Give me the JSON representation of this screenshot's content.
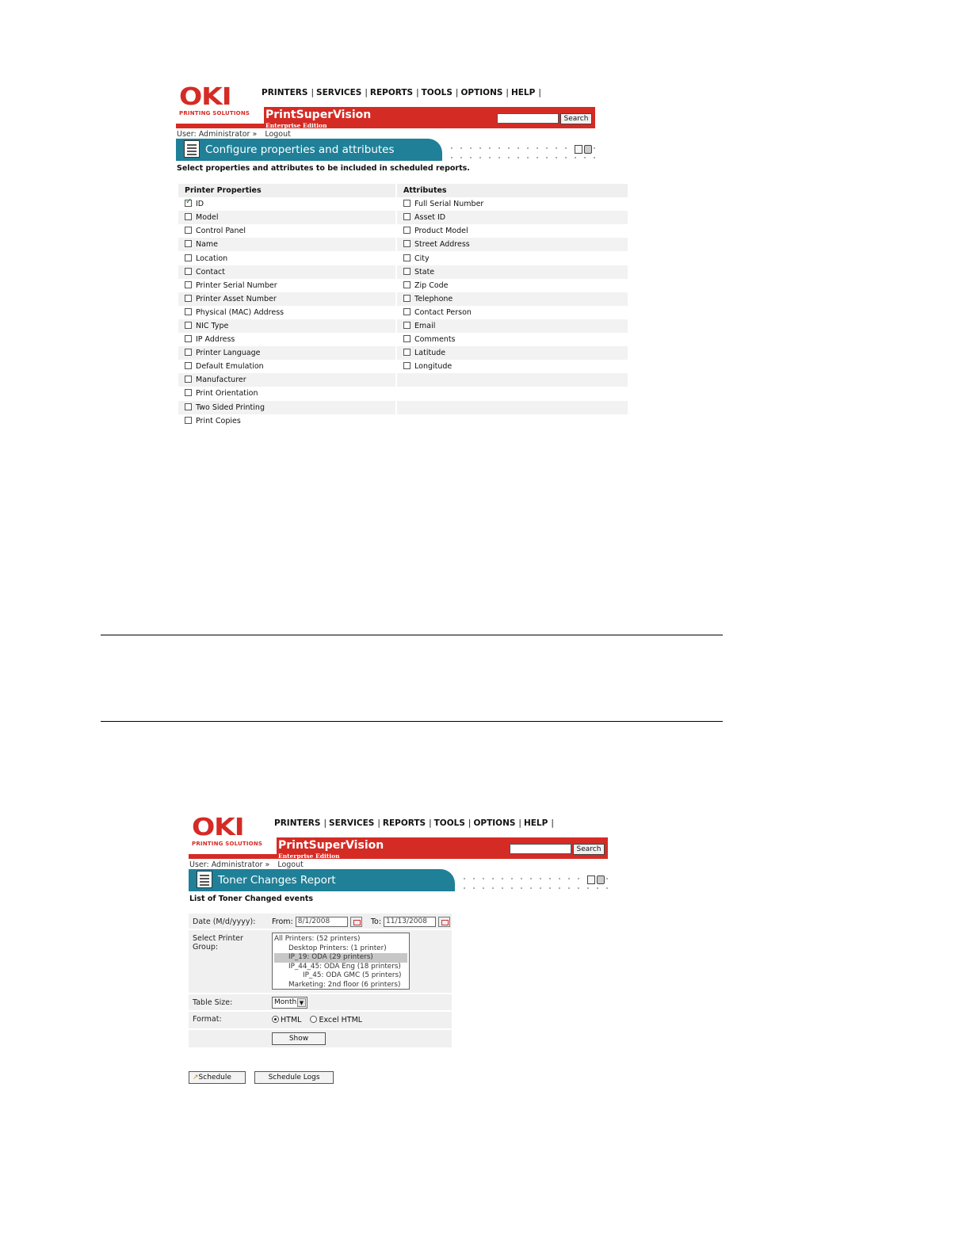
{
  "brand": {
    "logo": "OKI",
    "logo_sub": "PRINTING SOLUTIONS",
    "app_name": "PrintSuperVision",
    "edition": "Enterprise Edition"
  },
  "nav": [
    "PRINTERS",
    "SERVICES",
    "REPORTS",
    "TOOLS",
    "OPTIONS",
    "HELP"
  ],
  "nav_sep": "|",
  "search": {
    "button": "Search",
    "value": ""
  },
  "user": {
    "label": "User: Administrator »",
    "logout": "Logout"
  },
  "icons": [
    "document-icon",
    "edit-icon",
    "print-icon",
    "calendar-icon",
    "schedule-icon"
  ],
  "colors": {
    "brand_red": "#d52b25",
    "banner_teal": "#1f8098"
  },
  "shot1": {
    "banner_title": "Configure properties and attributes",
    "subtitle": "Select properties and attributes to be included in scheduled reports.",
    "col1_header": "Printer Properties",
    "col2_header": "Attributes",
    "properties": [
      {
        "label": "ID",
        "checked": true
      },
      {
        "label": "Model",
        "checked": false
      },
      {
        "label": "Control Panel",
        "checked": false
      },
      {
        "label": "Name",
        "checked": false
      },
      {
        "label": "Location",
        "checked": false
      },
      {
        "label": "Contact",
        "checked": false
      },
      {
        "label": "Printer Serial Number",
        "checked": false
      },
      {
        "label": "Printer Asset Number",
        "checked": false
      },
      {
        "label": "Physical (MAC) Address",
        "checked": false
      },
      {
        "label": "NIC Type",
        "checked": false
      },
      {
        "label": "IP Address",
        "checked": false
      },
      {
        "label": "Printer Language",
        "checked": false
      },
      {
        "label": "Default Emulation",
        "checked": false
      },
      {
        "label": "Manufacturer",
        "checked": false
      },
      {
        "label": "Print Orientation",
        "checked": false
      },
      {
        "label": "Two Sided Printing",
        "checked": false
      },
      {
        "label": "Print Copies",
        "checked": false
      }
    ],
    "attributes": [
      {
        "label": "Full Serial Number",
        "checked": false
      },
      {
        "label": "Asset ID",
        "checked": false
      },
      {
        "label": "Product Model",
        "checked": false
      },
      {
        "label": "Street Address",
        "checked": false
      },
      {
        "label": "City",
        "checked": false
      },
      {
        "label": "State",
        "checked": false
      },
      {
        "label": "Zip Code",
        "checked": false
      },
      {
        "label": "Telephone",
        "checked": false
      },
      {
        "label": "Contact Person",
        "checked": false
      },
      {
        "label": "Email",
        "checked": false
      },
      {
        "label": "Comments",
        "checked": false
      },
      {
        "label": "Latitude",
        "checked": false
      },
      {
        "label": "Longitude",
        "checked": false
      }
    ]
  },
  "shot2": {
    "banner_title": "Toner Changes Report",
    "subtitle": "List of Toner Changed events",
    "date_label": "Date (M/d/yyyy):",
    "from_label": "From:",
    "from_value": "8/1/2008",
    "to_label": "To:",
    "to_value": "11/13/2008",
    "group_label": "Select Printer Group:",
    "groups": [
      {
        "label": "All Printers: (52 printers)",
        "indent": 0,
        "selected": false
      },
      {
        "label": "Desktop Printers: (1 printer)",
        "indent": 1,
        "selected": false
      },
      {
        "label": "IP_19: ODA (29 printers)",
        "indent": 1,
        "selected": true
      },
      {
        "label": "IP_44_45: ODA Eng (18 printers)",
        "indent": 1,
        "selected": false
      },
      {
        "label": "IP_45: ODA GMC (5 printers)",
        "indent": 2,
        "selected": false
      },
      {
        "label": "Marketing: 2nd floor (6 printers)",
        "indent": 1,
        "selected": false
      }
    ],
    "table_size_label": "Table Size:",
    "table_size_value": "Month",
    "format_label": "Format:",
    "format_options": [
      "HTML",
      "Excel HTML"
    ],
    "format_selected": "HTML",
    "show_button": "Show",
    "schedule_button": "Schedule",
    "schedule_logs_button": "Schedule Logs"
  }
}
